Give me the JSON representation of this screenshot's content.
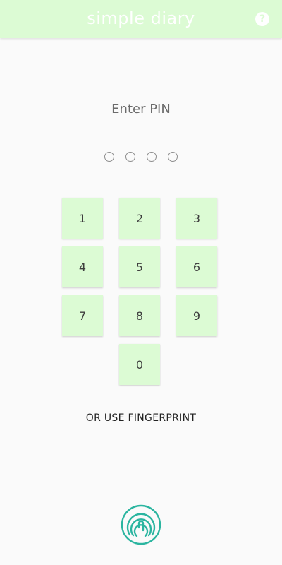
{
  "app_bar": {
    "title": "simple diary",
    "help_icon": "help-circle-icon",
    "background": "#dcfbd4"
  },
  "pin": {
    "prompt": "Enter PIN",
    "length": 4,
    "entered": 0
  },
  "keypad": {
    "keys": [
      "1",
      "2",
      "3",
      "4",
      "5",
      "6",
      "7",
      "8",
      "9",
      "0"
    ],
    "key_color": "#dcfbd4"
  },
  "alternative": {
    "label": "OR USE FINGERPRINT",
    "icon": "fingerprint-icon",
    "icon_color": "#2bb5a0"
  }
}
